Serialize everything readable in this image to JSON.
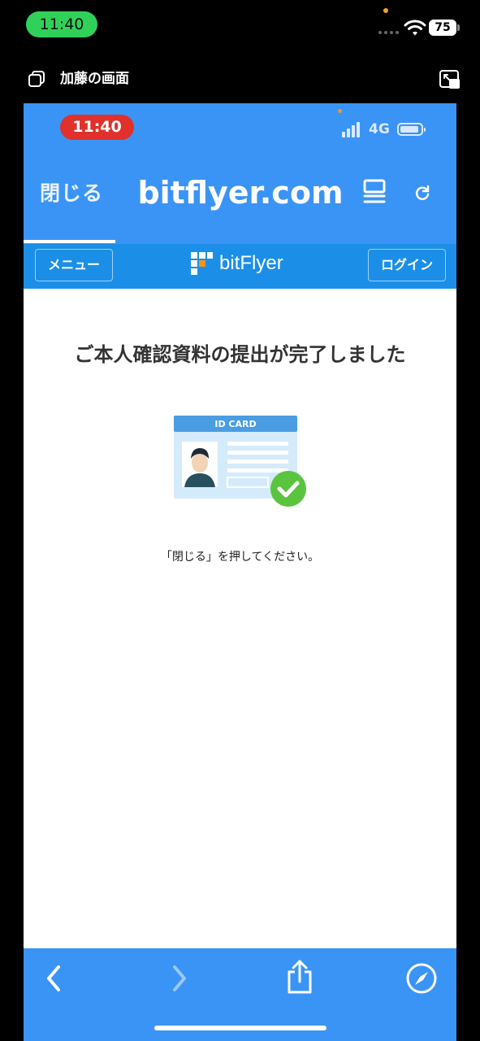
{
  "outer_status": {
    "time": "11:40",
    "battery": "75"
  },
  "share_bar": {
    "label": "加藤の画面"
  },
  "inner_status": {
    "time": "11:40",
    "network": "4G"
  },
  "browser_header": {
    "close_label": "閉じる",
    "domain": "bitflyer.com"
  },
  "site_nav": {
    "menu_label": "メニュー",
    "brand_name": "bitFlyer",
    "login_label": "ログイン"
  },
  "content": {
    "title": "ご本人確認資料の提出が完了しました",
    "card_label": "ID CARD",
    "instruction": "「閉じる」を押してください。"
  },
  "icons": {
    "share_screen": "screen-share-icon",
    "exit_fullscreen": "exit-fullscreen-icon",
    "reader": "reader-icon",
    "reload": "reload-icon",
    "back": "chevron-left-icon",
    "forward": "chevron-right-icon",
    "share": "share-icon",
    "compass": "compass-icon",
    "check": "check-icon"
  },
  "colors": {
    "header_blue": "#3a94f5",
    "nav_blue": "#1b8fe8",
    "recording_red": "#e0312b",
    "call_green": "#30d158",
    "check_green": "#5ac43e"
  }
}
